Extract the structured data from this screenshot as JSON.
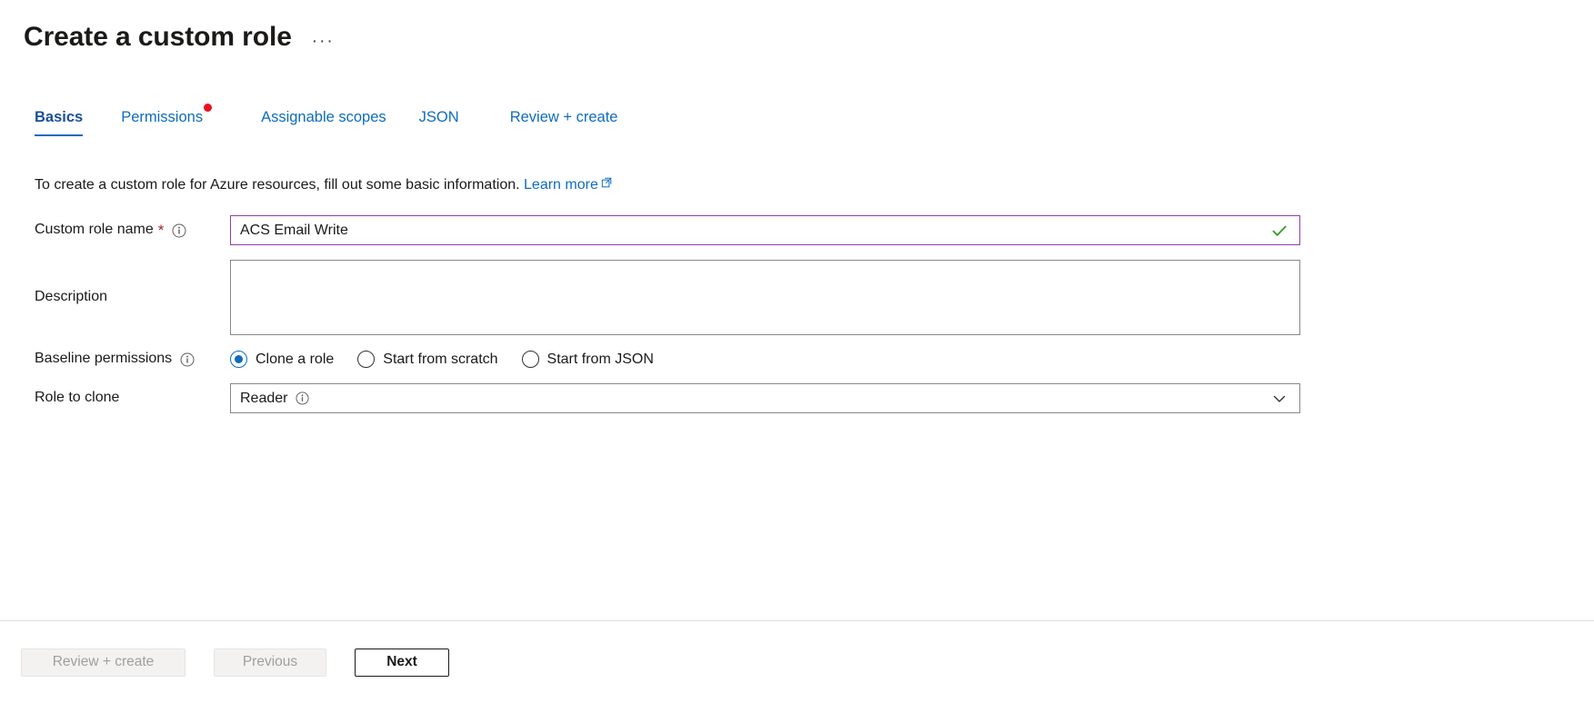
{
  "header": {
    "title": "Create a custom role",
    "ellipsis": "···"
  },
  "tabs": [
    {
      "label": "Basics",
      "active": true,
      "badge": false
    },
    {
      "label": "Permissions",
      "active": false,
      "badge": true
    },
    {
      "label": "Assignable scopes",
      "active": false,
      "badge": false
    },
    {
      "label": "JSON",
      "active": false,
      "badge": false
    },
    {
      "label": "Review + create",
      "active": false,
      "badge": false
    }
  ],
  "intro": {
    "text": "To create a custom role for Azure resources, fill out some basic information.",
    "link_label": "Learn more",
    "link_icon": "external-link-icon"
  },
  "form": {
    "role_name": {
      "label": "Custom role name",
      "required_marker": "*",
      "info_icon": "info-icon",
      "value": "ACS Email Write",
      "placeholder": "",
      "validation_icon": "checkmark-icon",
      "border_color": "#8e3fa8",
      "validation_color": "#3c9e2f"
    },
    "description": {
      "label": "Description",
      "value": "",
      "placeholder": ""
    },
    "baseline_permissions": {
      "label": "Baseline permissions",
      "info_icon": "info-icon",
      "options": [
        {
          "label": "Clone a role",
          "selected": true
        },
        {
          "label": "Start from scratch",
          "selected": false
        },
        {
          "label": "Start from JSON",
          "selected": false
        }
      ],
      "accent_color": "#0f6cbd"
    },
    "role_to_clone": {
      "label": "Role to clone",
      "value": "Reader",
      "info_icon": "info-icon",
      "chevron_icon": "chevron-down-icon"
    }
  },
  "footer": {
    "review_create": "Review + create",
    "previous": "Previous",
    "next": "Next"
  }
}
